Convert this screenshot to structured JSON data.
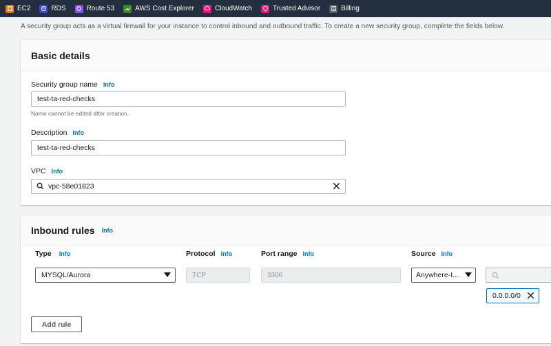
{
  "favorites": [
    {
      "label": "EC2",
      "icon": "ec2-icon",
      "color": "#e7791a"
    },
    {
      "label": "RDS",
      "icon": "rds-icon",
      "color": "#3b48cc"
    },
    {
      "label": "Route 53",
      "icon": "route53-icon",
      "color": "#8c4fff"
    },
    {
      "label": "AWS Cost Explorer",
      "icon": "cost-explorer-icon",
      "color": "#3f8624"
    },
    {
      "label": "CloudWatch",
      "icon": "cloudwatch-icon",
      "color": "#e7157b"
    },
    {
      "label": "Trusted Advisor",
      "icon": "trusted-advisor-icon",
      "color": "#e7157b"
    },
    {
      "label": "Billing",
      "icon": "billing-icon",
      "color": "#545b64"
    }
  ],
  "intro": "A security group acts as a virtual firewall for your instance to control inbound and outbound traffic. To create a new security group, complete the fields below.",
  "basic": {
    "title": "Basic details",
    "name_label": "Security group name",
    "name_info": "Info",
    "name_value": "test-ta-red-checks",
    "name_hint": "Name cannot be edited after creation.",
    "desc_label": "Description",
    "desc_info": "Info",
    "desc_value": "test-ta-red-checks",
    "vpc_label": "VPC",
    "vpc_info": "Info",
    "vpc_value": "vpc-58e01823"
  },
  "inbound": {
    "title": "Inbound rules",
    "title_info": "Info",
    "col_type": "Type",
    "col_type_info": "Info",
    "col_protocol": "Protocol",
    "col_protocol_info": "Info",
    "col_port": "Port range",
    "col_port_info": "Info",
    "col_source": "Source",
    "col_source_info": "Info",
    "rule": {
      "type": "MYSQL/Aurora",
      "protocol": "TCP",
      "port": "3306",
      "source": "Anywhere-I...",
      "cidr": "0.0.0.0/0"
    },
    "add_rule": "Add rule"
  },
  "colors": {
    "accent": "#0073bb",
    "topbar": "#232f3e"
  }
}
